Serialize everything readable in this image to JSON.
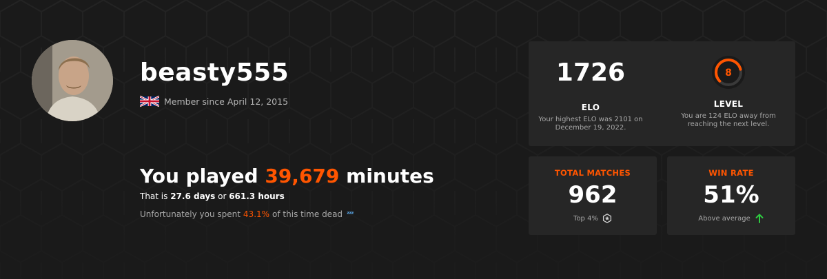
{
  "profile": {
    "username": "beasty555",
    "member_since": "Member since April 12, 2015",
    "flag_icon": "uk-flag-icon"
  },
  "playtime": {
    "prefix": "You played ",
    "minutes": "39,679",
    "suffix": " minutes",
    "detail_prefix": "That is ",
    "days": "27.6 days",
    "detail_mid": " or ",
    "hours": "661.3 hours",
    "dead_prefix": "Unfortunately you spent",
    "dead_percent": "43.1%",
    "dead_suffix": "of this time dead",
    "sleep_icon": "zzz-icon"
  },
  "elo_card": {
    "elo_value": "1726",
    "elo_label": "ELO",
    "elo_desc": "Your highest ELO was 2101 on December 19, 2022.",
    "level_value": "8",
    "level_progress": 0.78,
    "level_label": "LEVEL",
    "level_desc": "You are 124 ELO away from reaching the next level."
  },
  "matches_card": {
    "title": "TOTAL MATCHES",
    "value": "962",
    "foot": "Top 4%",
    "foot_icon": "star-badge-icon"
  },
  "winrate_card": {
    "title": "WIN RATE",
    "value": "51%",
    "foot": "Above average",
    "foot_icon": "arrow-up-icon"
  },
  "colors": {
    "background": "#1a1a1a",
    "card": "#262626",
    "accent": "#ff5500",
    "muted": "#a8a8a8",
    "up_arrow": "#2ecc40"
  }
}
